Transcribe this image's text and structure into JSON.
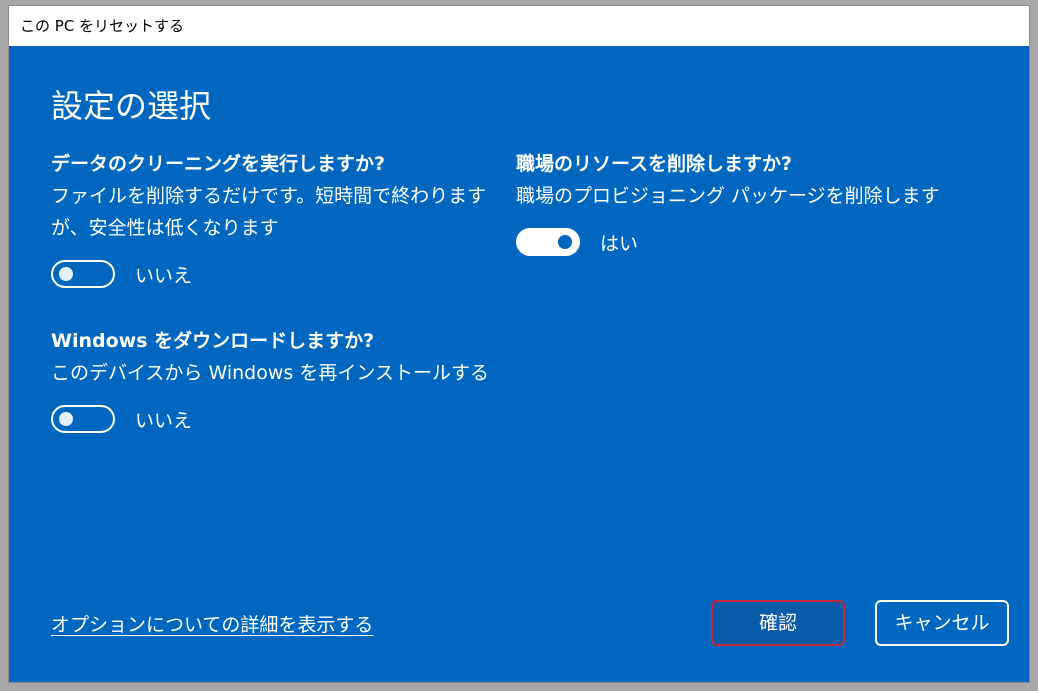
{
  "window": {
    "title": "この PC をリセットする"
  },
  "page": {
    "heading": "設定の選択"
  },
  "sections": {
    "clean": {
      "title": "データのクリーニングを実行しますか?",
      "description": "ファイルを削除するだけです。短時間で終わりますが、安全性は低くなります",
      "toggle_label": "いいえ",
      "toggle_on": false
    },
    "download": {
      "title": "Windows をダウンロードしますか?",
      "description": "このデバイスから Windows を再インストールする",
      "toggle_label": "いいえ",
      "toggle_on": false
    },
    "workplace": {
      "title": "職場のリソースを削除しますか?",
      "description": "職場のプロビジョニング パッケージを削除します",
      "toggle_label": "はい",
      "toggle_on": true
    }
  },
  "footer": {
    "details_link": "オプションについての詳細を表示する",
    "confirm_label": "確認",
    "cancel_label": "キャンセル"
  },
  "colors": {
    "background": "#0067c0",
    "titlebar": "#ffffff",
    "text": "#ffffff",
    "confirm_focus_border": "#c3273d"
  }
}
